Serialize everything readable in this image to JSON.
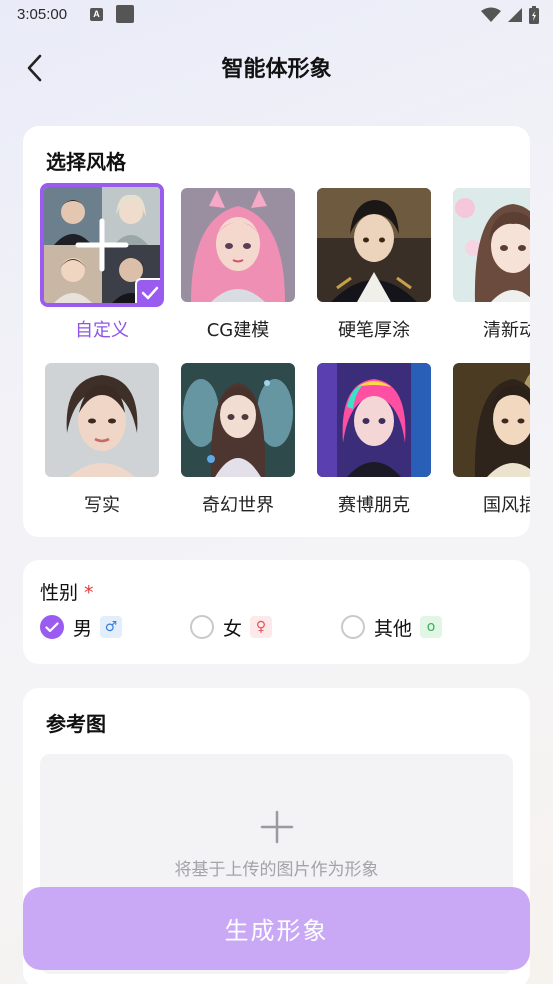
{
  "status_bar": {
    "time": "3:05:00",
    "a_badge": "A"
  },
  "header": {
    "title": "智能体形象",
    "back_icon": "chevron-left-icon"
  },
  "style_section": {
    "title": "选择风格",
    "items": [
      {
        "label": "自定义",
        "selected": true
      },
      {
        "label": "CG建模",
        "selected": false
      },
      {
        "label": "硬笔厚涂",
        "selected": false
      },
      {
        "label": "清新动",
        "selected": false
      },
      {
        "label": "写实",
        "selected": false
      },
      {
        "label": "奇幻世界",
        "selected": false
      },
      {
        "label": "赛博朋克",
        "selected": false
      },
      {
        "label": "国风插",
        "selected": false
      }
    ]
  },
  "gender_section": {
    "title": "性别",
    "required_mark": "*",
    "options": [
      {
        "label": "男",
        "symbol": "♂",
        "checked": true
      },
      {
        "label": "女",
        "symbol": "♀",
        "checked": false
      },
      {
        "label": "其他",
        "symbol": "o",
        "checked": false
      }
    ]
  },
  "reference_section": {
    "title": "参考图",
    "upload_hint": "将基于上传的图片作为形象"
  },
  "generate_button": {
    "label": "生成形象"
  },
  "colors": {
    "accent": "#9a5cf0",
    "button_disabled": "#c9a9f6",
    "required": "#e03a3a"
  }
}
